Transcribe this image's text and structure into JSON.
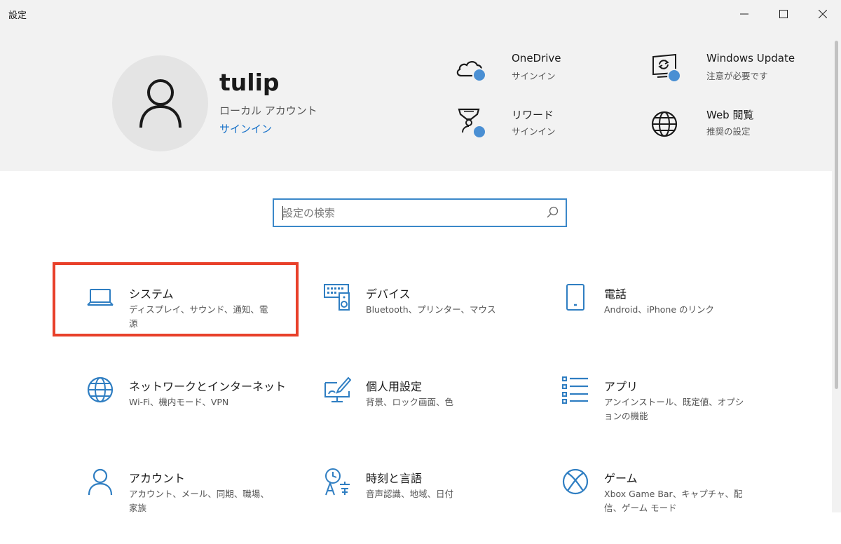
{
  "window": {
    "title": "設定",
    "controls": [
      "minimize-icon",
      "maximize-icon",
      "close-icon"
    ]
  },
  "account": {
    "username": "tulip",
    "type": "ローカル アカウント",
    "signin_link": "サインイン",
    "avatar_icon": "person-icon"
  },
  "services": [
    {
      "icon": "cloud-icon",
      "title": "OneDrive",
      "subtitle": "サインイン"
    },
    {
      "icon": "windows-update-icon",
      "title": "Windows Update",
      "subtitle": "注意が必要です"
    },
    {
      "icon": "trophy-icon",
      "title": "リワード",
      "subtitle": "サインイン"
    },
    {
      "icon": "globe-icon",
      "title": "Web 閲覧",
      "subtitle": "推奨の設定"
    }
  ],
  "search": {
    "placeholder": "設定の検索",
    "value": "",
    "icon": "search-icon"
  },
  "categories": [
    {
      "icon": "laptop-icon",
      "title": "システム",
      "subtitle": "ディスプレイ、サウンド、通知、電源",
      "highlighted": true
    },
    {
      "icon": "devices-icon",
      "title": "デバイス",
      "subtitle": "Bluetooth、プリンター、マウス"
    },
    {
      "icon": "phone-icon",
      "title": "電話",
      "subtitle": "Android、iPhone のリンク"
    },
    {
      "icon": "globe-icon",
      "title": "ネットワークとインターネット",
      "subtitle": "Wi-Fi、機内モード、VPN"
    },
    {
      "icon": "paintbrush-icon",
      "title": "個人用設定",
      "subtitle": "背景、ロック画面、色"
    },
    {
      "icon": "apps-list-icon",
      "title": "アプリ",
      "subtitle": "アンインストール、既定値、オプションの機能"
    },
    {
      "icon": "person-icon",
      "title": "アカウント",
      "subtitle": "アカウント、メール、同期、職場、家族"
    },
    {
      "icon": "time-language-icon",
      "title": "時刻と言語",
      "subtitle": "音声認識、地域、日付"
    },
    {
      "icon": "xbox-icon",
      "title": "ゲーム",
      "subtitle": "Xbox Game Bar、キャプチャ、配信、ゲーム モード"
    }
  ],
  "colors": {
    "accent": "#3b88c9",
    "link": "#1a73c9",
    "highlight_border": "#e8402a",
    "header_bg": "#f2f2f2",
    "badge": "#4a8fd3"
  }
}
